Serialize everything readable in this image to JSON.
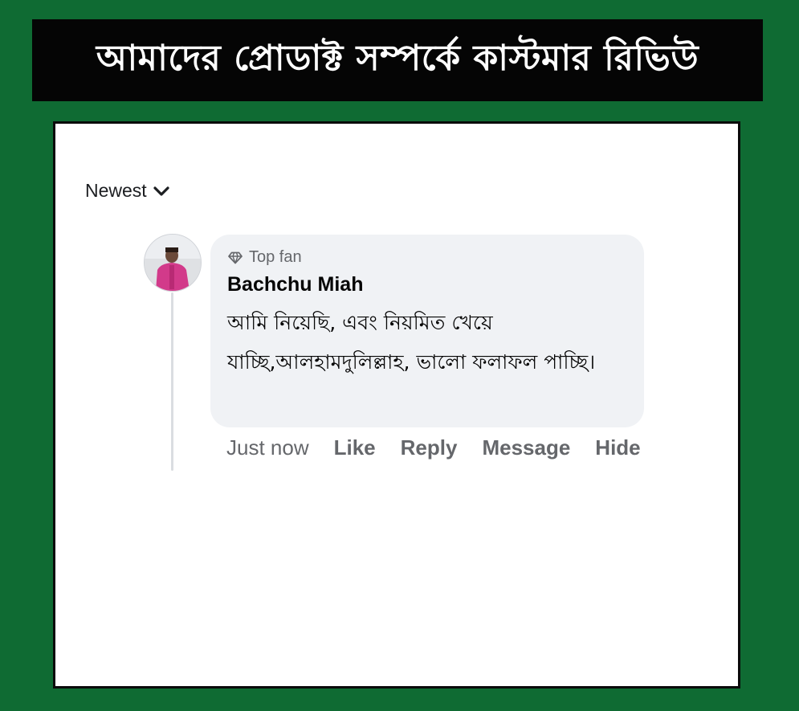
{
  "banner": {
    "title": "আমাদের প্রোডাক্ট সম্পর্কে কাস্টমার রিভিউ"
  },
  "sort": {
    "label": "Newest",
    "icon": "chevron-down-icon"
  },
  "comment": {
    "badge_icon": "diamond-icon",
    "badge_label": "Top fan",
    "author": "Bachchu Miah",
    "text": "আমি নিয়েছি, এবং নিয়মিত খেয়ে যাচ্ছি,আলহামদুলিল্লাহ,  ভালো ফলাফল পাচ্ছি।",
    "timestamp": "Just now",
    "actions": {
      "like": "Like",
      "reply": "Reply",
      "message": "Message",
      "hide": "Hide"
    }
  },
  "colors": {
    "page_background": "#0f6b33",
    "banner_background": "#050505",
    "bubble_background": "#f0f2f5",
    "secondary_text": "#65676b"
  }
}
